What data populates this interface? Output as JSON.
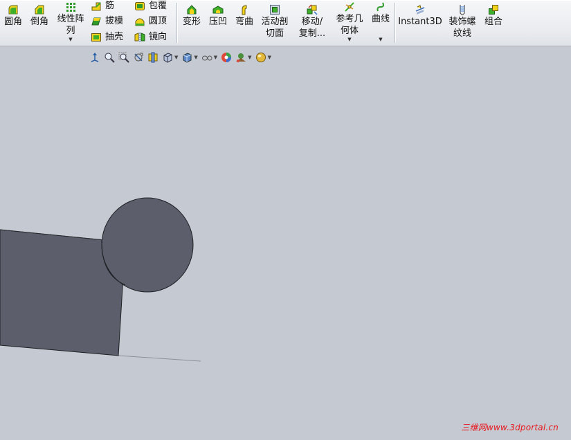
{
  "ribbon": {
    "fillet": "圆角",
    "chamfer": "倒角",
    "linear_pattern_l1": "线性阵",
    "linear_pattern_l2": "列",
    "rib": "筋",
    "draft": "拔模",
    "shell": "抽壳",
    "wrap": "包覆",
    "dome": "圆顶",
    "mirror": "镜向",
    "deform": "变形",
    "indent": "压凹",
    "flex": "弯曲",
    "live_section_l1": "活动剖",
    "live_section_l2": "切面",
    "move_copy_l1": "移动/",
    "move_copy_l2": "复制...",
    "ref_geometry_l1": "参考几",
    "ref_geometry_l2": "何体",
    "curves": "曲线",
    "instant3d": "Instant3D",
    "cosmetic_thread_l1": "装饰螺",
    "cosmetic_thread_l2": "纹线",
    "combine": "组合"
  },
  "view_toolbar": {
    "icons": [
      "previous-view-icon",
      "zoom-to-fit-icon",
      "zoom-to-area-icon",
      "rotate-view-icon",
      "section-view-icon",
      "view-orientation-icon",
      "display-style-icon",
      "hide-show-items-icon",
      "edit-appearance-icon",
      "apply-scene-icon",
      "view-settings-icon"
    ]
  },
  "colors": {
    "viewport_bg": "#c5c9d1",
    "part_fill": "#5c5f6b",
    "part_edge": "#1e1f24",
    "watermark": "#e8171d"
  },
  "watermark": "三维网www.3dportal.cn"
}
